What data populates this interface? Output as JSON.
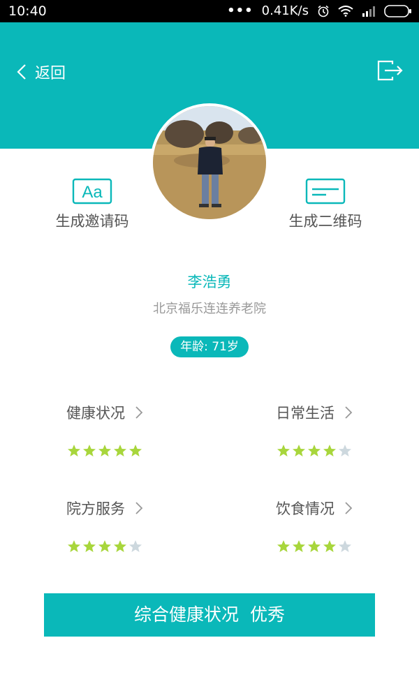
{
  "status_bar": {
    "time": "10:40",
    "network_speed": "0.41K/s"
  },
  "header": {
    "back_label": "返回"
  },
  "actions": {
    "invite_label": "生成邀请码",
    "qrcode_label": "生成二维码"
  },
  "profile": {
    "name": "李浩勇",
    "organization": "北京福乐连连养老院",
    "age": "年龄: 71岁"
  },
  "ratings": [
    {
      "label": "健康状况",
      "stars": 5,
      "max": 5
    },
    {
      "label": "日常生活",
      "stars": 4,
      "max": 5
    },
    {
      "label": "院方服务",
      "stars": 4,
      "max": 5
    },
    {
      "label": "饮食情况",
      "stars": 4,
      "max": 5
    }
  ],
  "summary": {
    "label": "综合健康状况",
    "value": "优秀"
  },
  "colors": {
    "accent": "#0ab8b9",
    "star_on": "#a8d63c",
    "star_off": "#cdd8de"
  }
}
